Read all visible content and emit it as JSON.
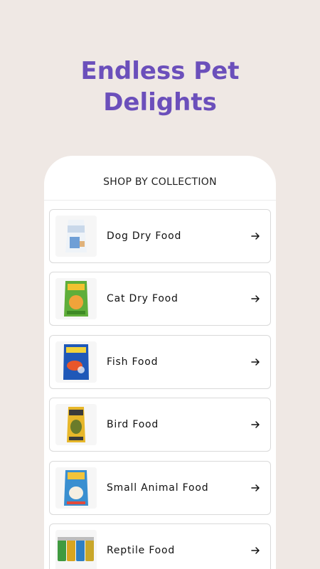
{
  "headline": {
    "line1": "Endless Pet",
    "line2": "Delights"
  },
  "panel": {
    "title": "SHOP BY COLLECTION"
  },
  "collections": [
    {
      "label": "Dog Dry Food",
      "icon": "arrow-right-icon"
    },
    {
      "label": "Cat Dry Food",
      "icon": "arrow-right-icon"
    },
    {
      "label": "Fish Food",
      "icon": "arrow-right-icon"
    },
    {
      "label": "Bird Food",
      "icon": "arrow-right-icon"
    },
    {
      "label": "Small Animal Food",
      "icon": "arrow-right-icon"
    },
    {
      "label": "Reptile Food",
      "icon": "arrow-right-icon"
    }
  ],
  "colors": {
    "background": "#efe8e4",
    "accent": "#6b4fbb"
  }
}
